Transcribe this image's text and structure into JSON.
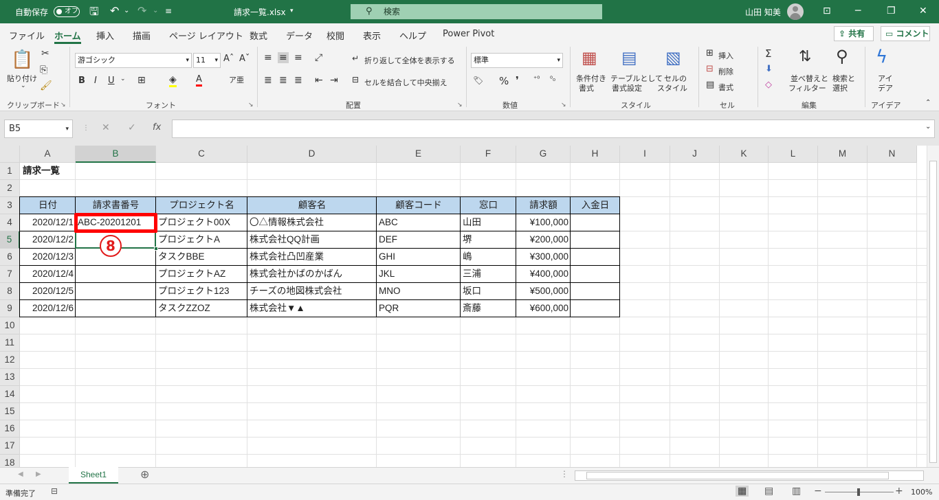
{
  "title_bar": {
    "autosave_label": "自動保存",
    "autosave_state": "オフ",
    "filename": "請求一覧.xlsx",
    "search_placeholder": "検索",
    "user_name": "山田 知美"
  },
  "menu_tabs": [
    "ファイル",
    "ホーム",
    "挿入",
    "描画",
    "ページ レイアウト",
    "数式",
    "データ",
    "校閲",
    "表示",
    "ヘルプ",
    "Power Pivot"
  ],
  "active_tab": "ホーム",
  "top_buttons": {
    "share": "共有",
    "comment": "コメント"
  },
  "ribbon": {
    "clipboard": {
      "paste": "貼り付け",
      "label": "クリップボード"
    },
    "font": {
      "name": "游ゴシック",
      "size": "11",
      "label": "フォント"
    },
    "alignment": {
      "wrap": "折り返して全体を表示する",
      "merge": "セルを結合して中央揃え",
      "label": "配置"
    },
    "number": {
      "format": "標準",
      "label": "数値"
    },
    "styles": {
      "conditional_1": "条件付き",
      "conditional_2": "書式",
      "table_1": "テーブルとして",
      "table_2": "書式設定",
      "cell_1": "セルの",
      "cell_2": "スタイル",
      "label": "スタイル"
    },
    "cells": {
      "insert": "挿入",
      "delete": "削除",
      "format": "書式",
      "label": "セル"
    },
    "editing": {
      "sort_1": "並べ替えと",
      "sort_2": "フィルター",
      "find_1": "検索と",
      "find_2": "選択",
      "label": "編集"
    },
    "ideas": {
      "btn_1": "アイ",
      "btn_2": "デア",
      "label": "アイデア"
    }
  },
  "formula_bar": {
    "name_box": "B5",
    "formula": ""
  },
  "columns": [
    "A",
    "B",
    "C",
    "D",
    "E",
    "F",
    "G",
    "H",
    "I",
    "J",
    "K",
    "L",
    "M",
    "N"
  ],
  "rows": [
    "1",
    "2",
    "3",
    "4",
    "5",
    "6",
    "7",
    "8",
    "9",
    "10",
    "11",
    "12",
    "13",
    "14",
    "15",
    "16",
    "17",
    "18"
  ],
  "sheet": {
    "title": "請求一覧",
    "headers": [
      "日付",
      "請求書番号",
      "プロジェクト名",
      "顧客名",
      "顧客コード",
      "窓口",
      "請求額",
      "入金日"
    ],
    "data": [
      [
        "2020/12/1",
        "ABC-20201201",
        "プロジェクト00X",
        "〇△情報株式会社",
        "ABC",
        "山田",
        "¥100,000",
        ""
      ],
      [
        "2020/12/2",
        "",
        "プロジェクトA",
        "株式会社QQ計画",
        "DEF",
        "堺",
        "¥200,000",
        ""
      ],
      [
        "2020/12/3",
        "",
        "タスクBBE",
        "株式会社凸凹産業",
        "GHI",
        "嶋",
        "¥300,000",
        ""
      ],
      [
        "2020/12/4",
        "",
        "プロジェクトAZ",
        "株式会社かばのかばん",
        "JKL",
        "三浦",
        "¥400,000",
        ""
      ],
      [
        "2020/12/5",
        "",
        "プロジェクト123",
        "チーズの地図株式会社",
        "MNO",
        "坂口",
        "¥500,000",
        ""
      ],
      [
        "2020/12/6",
        "",
        "タスクZZOZ",
        "株式会社▼▲",
        "PQR",
        "斎藤",
        "¥600,000",
        ""
      ]
    ]
  },
  "annotation_marker": "8",
  "sheet_tab": "Sheet1",
  "status": {
    "ready": "準備完了",
    "zoom": "100%"
  },
  "colors": {
    "excel_green": "#217346",
    "header_fill": "#bdd7ee",
    "highlight_red": "#ff0000"
  }
}
